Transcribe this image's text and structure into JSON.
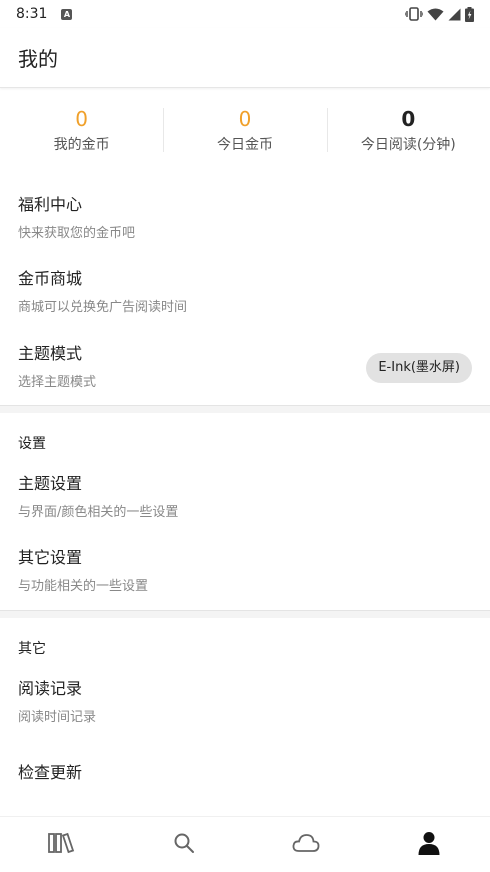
{
  "status_bar": {
    "time": "8:31",
    "app_badge": "A"
  },
  "header": {
    "title": "我的"
  },
  "stats": [
    {
      "value": "0",
      "label": "我的金币"
    },
    {
      "value": "0",
      "label": "今日金币"
    },
    {
      "value": "0",
      "label": "今日阅读(分钟)"
    }
  ],
  "main_items": [
    {
      "title": "福利中心",
      "subtitle": "快来获取您的金币吧"
    },
    {
      "title": "金币商城",
      "subtitle": "商城可以兑换免广告阅读时间"
    },
    {
      "title": "主题模式",
      "subtitle": "选择主题模式",
      "value": "E-Ink(墨水屏)"
    }
  ],
  "settings": {
    "title": "设置",
    "items": [
      {
        "title": "主题设置",
        "subtitle": "与界面/颜色相关的一些设置"
      },
      {
        "title": "其它设置",
        "subtitle": "与功能相关的一些设置"
      }
    ]
  },
  "other": {
    "title": "其它",
    "items": [
      {
        "title": "阅读记录",
        "subtitle": "阅读时间记录"
      },
      {
        "title": "检查更新"
      }
    ]
  },
  "bottom_nav": {
    "tabs": [
      {
        "icon": "bookshelf-icon"
      },
      {
        "icon": "search-icon"
      },
      {
        "icon": "cloud-icon"
      },
      {
        "icon": "person-icon",
        "active": true
      }
    ]
  },
  "colors": {
    "accent": "#f0a02a",
    "text": "#222222",
    "subtext": "#888888",
    "chip_bg": "#e2e2e2"
  }
}
